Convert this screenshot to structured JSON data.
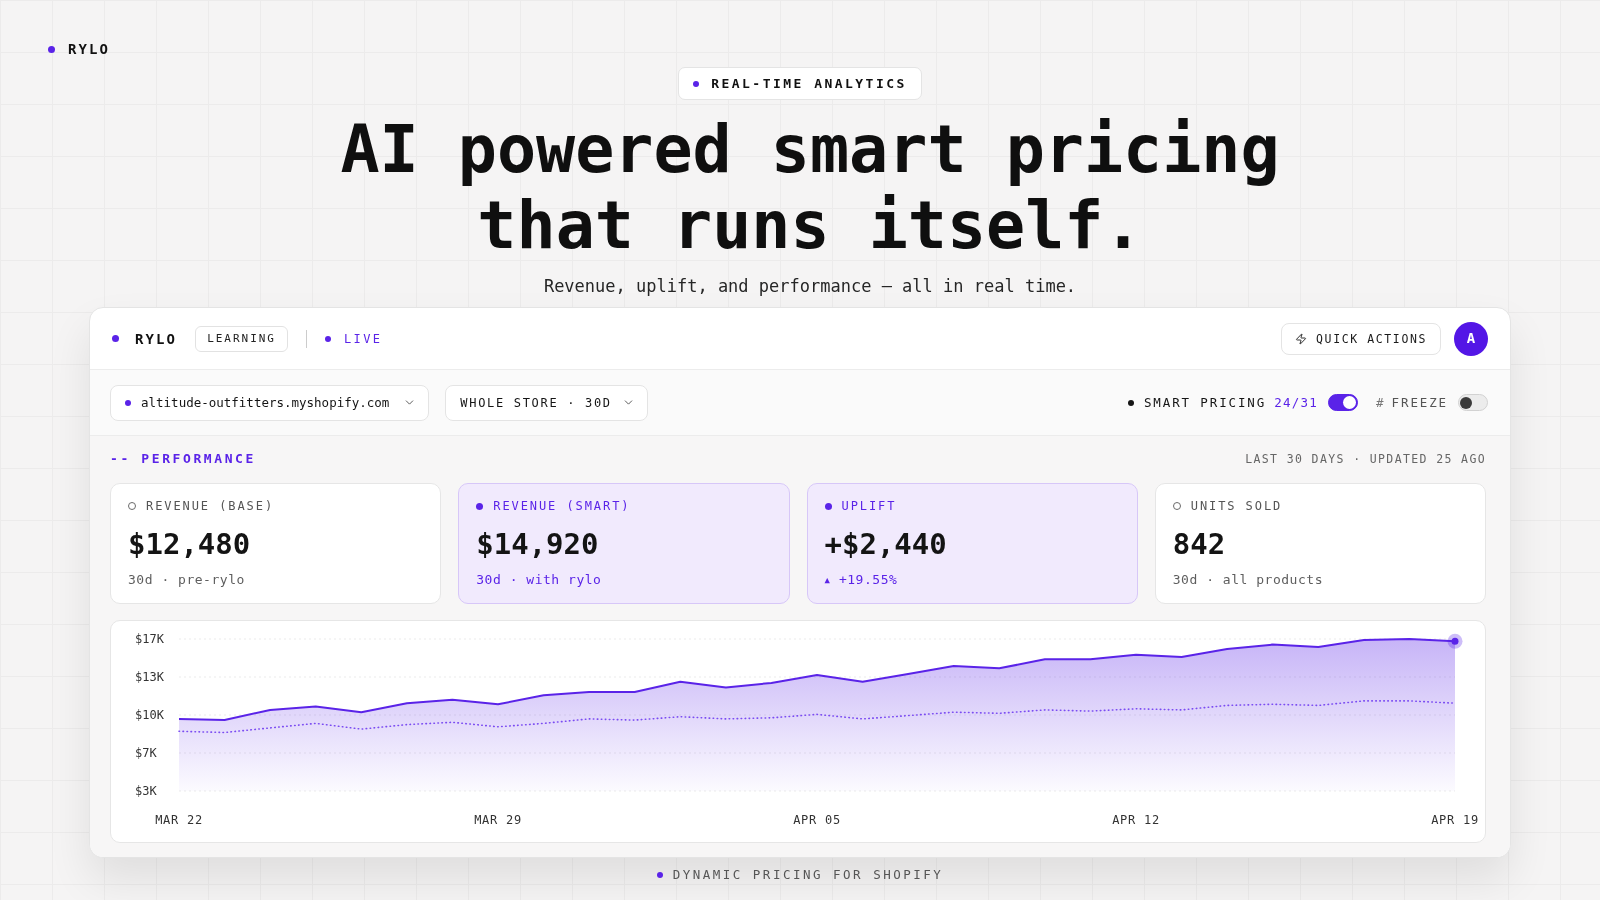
{
  "brand": {
    "name": "RYLO"
  },
  "hero": {
    "tag": "REAL-TIME ANALYTICS",
    "title": "AI powered smart pricing that runs itself.",
    "subtitle": "Revenue, uplift, and performance — all in real time."
  },
  "dashboard": {
    "header": {
      "brand": "RYLO",
      "mode": "LEARNING",
      "status": "LIVE",
      "quick_actions": "QUICK ACTIONS",
      "avatar": "A"
    },
    "filters": {
      "store": "altitude-outfitters.myshopify.com",
      "scope": "WHOLE STORE · 30D",
      "smart_pricing": {
        "label": "SMART PRICING",
        "count": "24/31",
        "on": true
      },
      "freeze": {
        "symbol": "#",
        "label": "FREEZE",
        "on": false
      }
    },
    "performance": {
      "title": "-- PERFORMANCE",
      "meta": "LAST 30 DAYS · UPDATED 25 AGO",
      "metrics": [
        {
          "label": "REVENUE (BASE)",
          "value": "$12,480",
          "note": "30d · pre-rylo",
          "highlighted": false
        },
        {
          "label": "REVENUE (SMART)",
          "value": "$14,920",
          "note": "30d · with rylo",
          "highlighted": true
        },
        {
          "label": "UPLIFT",
          "value": "+$2,440",
          "trend_symbol": "▲",
          "note": "+19.55%",
          "highlighted": true
        },
        {
          "label": "UNITS SOLD",
          "value": "842",
          "note": "30d · all products",
          "highlighted": false
        }
      ],
      "chart_data": {
        "type": "area",
        "categories": [
          "MAR 22",
          null,
          null,
          null,
          null,
          null,
          null,
          "MAR 29",
          null,
          null,
          null,
          null,
          null,
          null,
          "APR 05",
          null,
          null,
          null,
          null,
          null,
          null,
          "APR 12",
          null,
          null,
          null,
          null,
          null,
          null,
          "APR 19"
        ],
        "ylim": [
          3300,
          16800
        ],
        "yticks": [
          {
            "value": 16800,
            "label": "$17K"
          },
          {
            "value": 13425,
            "label": "$13K"
          },
          {
            "value": 10050,
            "label": "$10K"
          },
          {
            "value": 6675,
            "label": "$7K"
          },
          {
            "value": 3300,
            "label": "$3K"
          }
        ],
        "grid": true,
        "series": [
          {
            "type": "area",
            "color": "#5a23e8",
            "values": [
              9700,
              9600,
              10500,
              10800,
              10300,
              11100,
              11400,
              11000,
              11800,
              12100,
              12100,
              13000,
              12500,
              12900,
              13600,
              13000,
              13700,
              14400,
              14200,
              15000,
              15000,
              15400,
              15200,
              15900,
              16300,
              16100,
              16700,
              16800,
              16600
            ]
          },
          {
            "type": "line",
            "line_style": "dotted",
            "color": "#7b4cf2",
            "values": [
              8600,
              8500,
              8900,
              9300,
              8800,
              9200,
              9400,
              9000,
              9300,
              9700,
              9600,
              9900,
              9700,
              9800,
              10100,
              9700,
              10000,
              10300,
              10200,
              10500,
              10400,
              10600,
              10500,
              10900,
              11000,
              10900,
              11300,
              11300,
              11100
            ]
          }
        ]
      }
    }
  },
  "footer": {
    "tagline": "DYNAMIC PRICING FOR SHOPIFY"
  }
}
